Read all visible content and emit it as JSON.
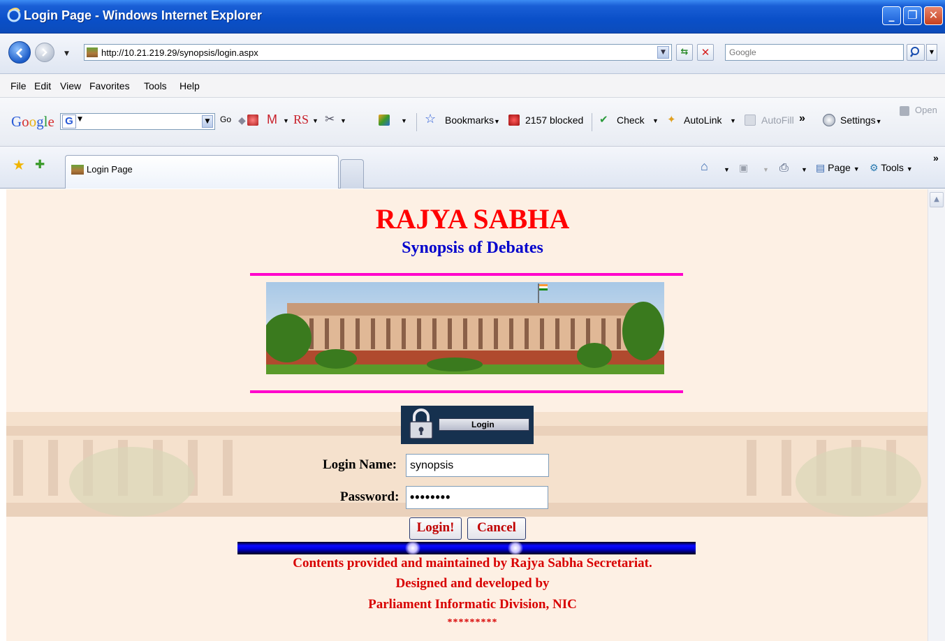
{
  "window": {
    "title": "Login Page - Windows Internet Explorer"
  },
  "address_bar": {
    "url": "http://10.21.219.29/synopsis/login.aspx",
    "search_placeholder": "Google"
  },
  "menu": {
    "items": [
      "File",
      "Edit",
      "View",
      "Favorites",
      "Tools",
      "Help"
    ]
  },
  "google_toolbar": {
    "go_label": "Go",
    "rs_label": "RS",
    "bookmarks_label": "Bookmarks",
    "blocked_label": "2157 blocked",
    "check_label": "Check",
    "autolink_label": "AutoLink",
    "autofill_label": "AutoFill",
    "more_label": "»",
    "settings_label": "Settings",
    "open_label": "Open"
  },
  "tabs": {
    "active_label": "Login Page"
  },
  "command_bar": {
    "page_label": "Page",
    "tools_label": "Tools",
    "more_label": "»"
  },
  "page": {
    "heading": "RAJYA SABHA",
    "subheading": "Synopsis of Debates",
    "login_banner_label": "Login",
    "login_name_label": "Login Name:",
    "login_name_value": "synopsis",
    "password_label": "Password:",
    "password_value": "synopsis",
    "login_button": "Login!",
    "cancel_button": "Cancel",
    "footer_line1": "Contents provided and maintained by Rajya Sabha Secretariat.",
    "footer_line2": "Designed and developed by",
    "footer_line3": "Parliament Informatic Division, NIC",
    "footer_stars": "*********"
  },
  "colors": {
    "heading": "#ff0000",
    "subheading": "#0000cc",
    "divider": "#ff00cc",
    "footer_text": "#d80000",
    "page_background": "#fdf0e4",
    "titlebar": "#0a4fc8"
  }
}
